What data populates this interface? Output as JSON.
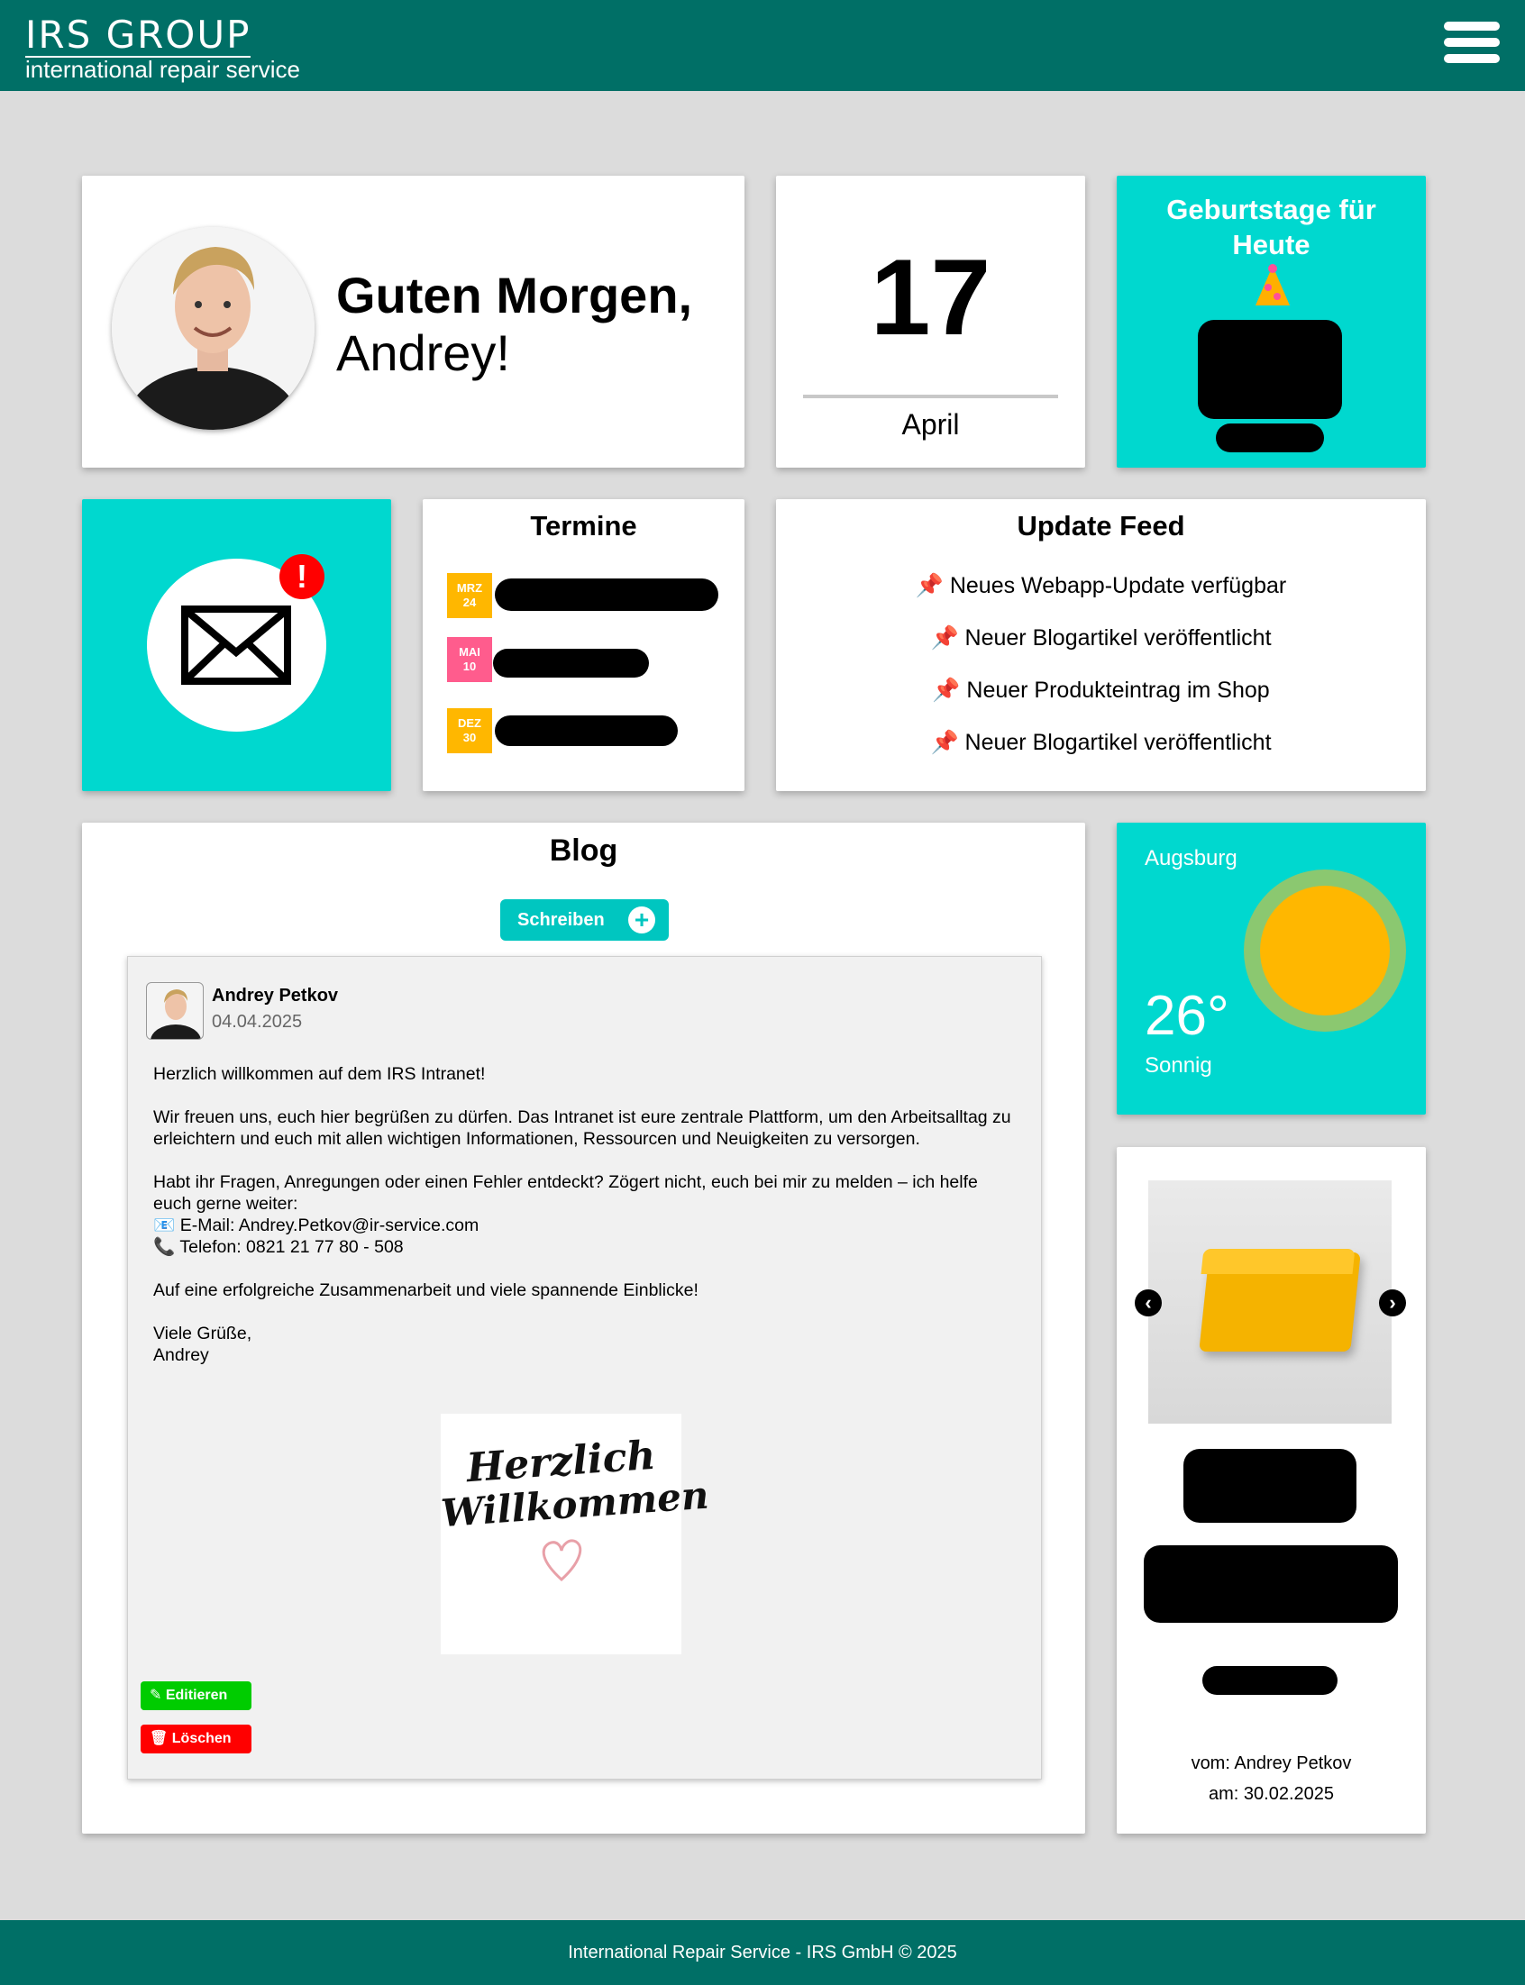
{
  "header": {
    "logo_main": "IRS GROUP",
    "logo_sub": "international repair service"
  },
  "greeting": {
    "line1": "Guten Morgen,",
    "line2": "Andrey!"
  },
  "date": {
    "day": "17",
    "month": "April"
  },
  "birthdays": {
    "title": "Geburtstage für Heute"
  },
  "termine": {
    "title": "Termine",
    "items": [
      {
        "month": "MRZ",
        "day": "24",
        "color": "#ffb700"
      },
      {
        "month": "MAI",
        "day": "10",
        "color": "#ff5c8d"
      },
      {
        "month": "DEZ",
        "day": "30",
        "color": "#ffb700"
      }
    ]
  },
  "update_feed": {
    "title": "Update Feed",
    "items": [
      "📌 Neues Webapp-Update verfügbar",
      "📌 Neuer Blogartikel veröffentlicht",
      "📌 Neuer Produkteintrag im Shop",
      "📌 Neuer Blogartikel veröffentlicht"
    ]
  },
  "blog": {
    "title": "Blog",
    "write_label": "Schreiben",
    "post": {
      "author": "Andrey Petkov",
      "date": "04.04.2025",
      "p1": "Herzlich willkommen auf dem IRS Intranet!",
      "p2": "Wir freuen uns, euch hier begrüßen zu dürfen. Das Intranet ist eure zentrale Plattform, um den Arbeitsalltag zu erleichtern und euch mit allen wichtigen Informationen, Ressourcen und Neuigkeiten zu versorgen.",
      "p3": "Habt ihr Fragen, Anregungen oder einen Fehler entdeckt? Zögert nicht, euch bei mir zu melden – ich helfe euch gerne weiter:",
      "email": "📧 E-Mail: Andrey.Petkov@ir-service.com",
      "phone": "📞 Telefon: 0821 21 77 80 - 508",
      "p4": "Auf eine erfolgreiche Zusammenarbeit und viele spannende Einblicke!",
      "closing1": "Viele Grüße,",
      "closing2": "Andrey",
      "image_line1": "Herzlich",
      "image_line2": "Willkommen",
      "edit_label": "Editieren",
      "delete_label": "Löschen"
    }
  },
  "weather": {
    "city": "Augsburg",
    "temp": "26°",
    "condition": "Sonnig"
  },
  "product": {
    "by": "vom: Andrey Petkov",
    "on": "am: 30.02.2025"
  },
  "footer": {
    "text": "International Repair Service - IRS GmbH © 2025"
  },
  "colors": {
    "header": "#006f66",
    "accent": "#00d8cf",
    "edit": "#00cc00",
    "delete": "#ff0000"
  }
}
